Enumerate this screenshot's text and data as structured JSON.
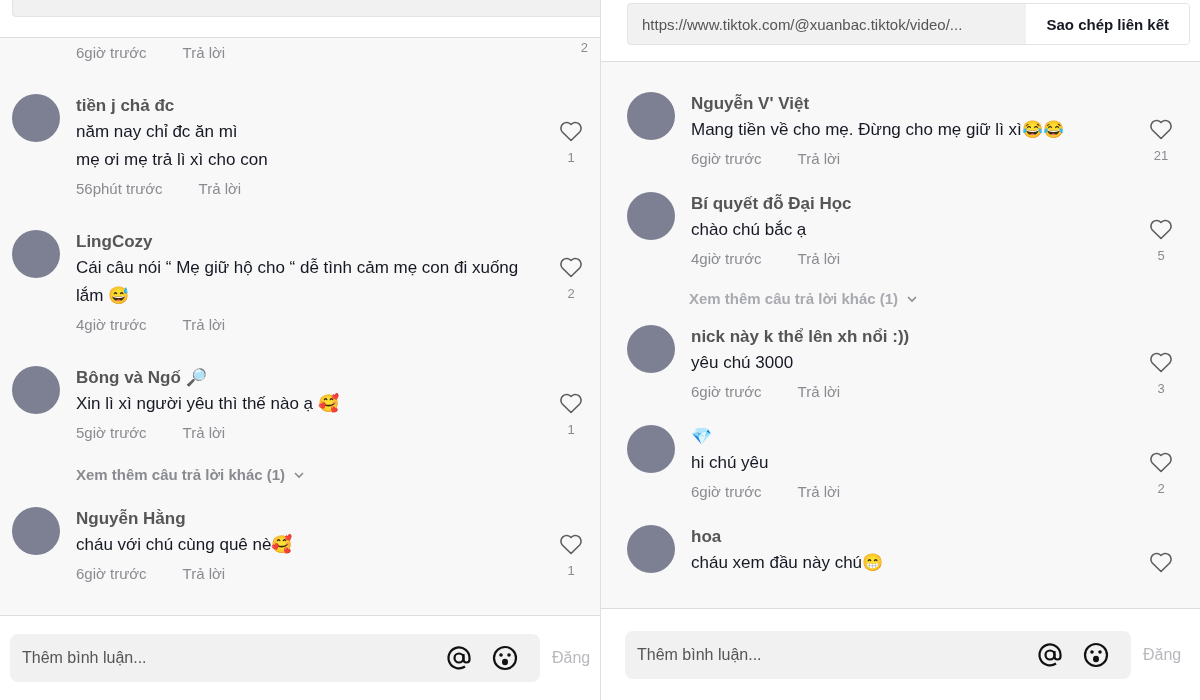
{
  "panels": [
    {
      "comments": [
        {
          "kind": "tail",
          "time": "6giờ trước",
          "reply": "Trả lời",
          "likes": "2"
        },
        {
          "kind": "comment",
          "name": "tiền j chả đc",
          "text": "năm nay chỉ đc ăn mì\nmẹ ơi mẹ trả lì xì cho con",
          "time": "56phút trước",
          "reply": "Trả lời",
          "likes": "1"
        },
        {
          "kind": "comment",
          "name": "LingCozy",
          "text": "Cái câu nói “ Mẹ giữ hộ cho “ dễ tình cảm mẹ con đi xuống lắm 😅",
          "time": "4giờ trước",
          "reply": "Trả lời",
          "likes": "2"
        },
        {
          "kind": "comment",
          "name": "Bông và Ngố 🔎",
          "text": "Xin lì xì người yêu thì thế nào ạ 🥰",
          "time": "5giờ trước",
          "reply": "Trả lời",
          "likes": "1"
        },
        {
          "kind": "more",
          "label": "Xem thêm câu trả lời khác (1)"
        },
        {
          "kind": "comment",
          "name": "Nguyễn Hằng",
          "text": "cháu với chú cùng quê nè🥰",
          "time": "6giờ trước",
          "reply": "Trả lời",
          "likes": "1"
        }
      ],
      "footer": {
        "placeholder": "Thêm bình luận...",
        "post": "Đăng"
      }
    },
    {
      "url_bar": {
        "url": "https://www.tiktok.com/@xuanbac.tiktok/video/...",
        "button": "Sao chép liên kết"
      },
      "comments": [
        {
          "kind": "comment",
          "name": "Nguyễn V' Việt",
          "text": "Mang tiền về cho mẹ. Đừng cho mẹ giữ lì xì😂😂",
          "time": "6giờ trước",
          "reply": "Trả lời",
          "likes": "21"
        },
        {
          "kind": "comment",
          "name": "Bí quyết đỗ Đại Học",
          "text": "chào chú bắc ạ",
          "time": "4giờ trước",
          "reply": "Trả lời",
          "likes": "5"
        },
        {
          "kind": "more",
          "label": "Xem thêm câu trả lời khác (1)"
        },
        {
          "kind": "comment",
          "name": "nick này k thể lên xh nổi :))",
          "text": "yêu chú 3000",
          "time": "6giờ trước",
          "reply": "Trả lời",
          "likes": "3"
        },
        {
          "kind": "comment",
          "name": "💎",
          "text": "hi chú yêu",
          "time": "6giờ trước",
          "reply": "Trả lời",
          "likes": "2"
        },
        {
          "kind": "comment",
          "name": "hoa",
          "text": "cháu xem đầu này chú😁"
        }
      ],
      "footer": {
        "placeholder": "Thêm bình luận...",
        "post": "Đăng"
      }
    }
  ]
}
